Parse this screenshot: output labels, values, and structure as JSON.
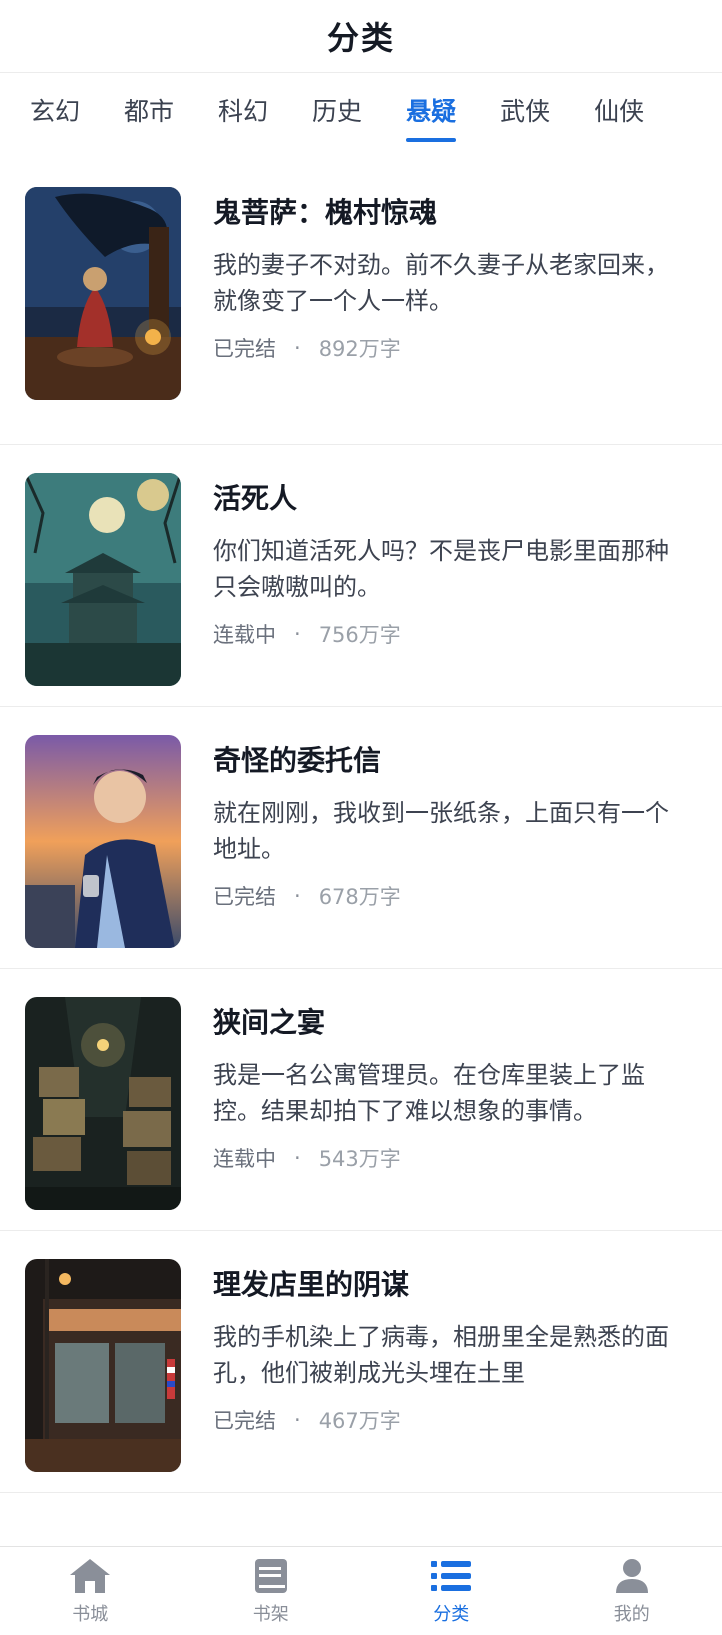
{
  "header": {
    "title": "分类"
  },
  "tabs": [
    {
      "label": "玄幻",
      "active": false
    },
    {
      "label": "都市",
      "active": false
    },
    {
      "label": "科幻",
      "active": false
    },
    {
      "label": "历史",
      "active": false
    },
    {
      "label": "悬疑",
      "active": true
    },
    {
      "label": "武侠",
      "active": false
    },
    {
      "label": "仙侠",
      "active": false
    }
  ],
  "books": [
    {
      "title": "鬼菩萨：槐村惊魂",
      "desc": "我的妻子不对劲。前不久妻子从老家回来，就像变了一个人一样。",
      "status": "已完结",
      "dot": "·",
      "words": "892万字"
    },
    {
      "title": "活死人",
      "desc": "你们知道活死人吗？不是丧尸电影里面那种只会嗷嗷叫的。",
      "status": "连载中",
      "dot": "·",
      "words": "756万字"
    },
    {
      "title": "奇怪的委托信",
      "desc": "就在刚刚，我收到一张纸条，上面只有一个地址。",
      "status": "已完结",
      "dot": "·",
      "words": "678万字"
    },
    {
      "title": "狭间之宴",
      "desc": "我是一名公寓管理员。在仓库里装上了监控。结果却拍下了难以想象的事情。",
      "status": "连载中",
      "dot": "·",
      "words": "543万字"
    },
    {
      "title": "理发店里的阴谋",
      "desc": "我的手机染上了病毒，相册里全是熟悉的面孔，他们被剃成光头埋在土里",
      "status": "已完结",
      "dot": "·",
      "words": "467万字"
    }
  ],
  "bottom_nav": [
    {
      "label": "书城",
      "icon": "home-icon",
      "active": false
    },
    {
      "label": "书架",
      "icon": "bookshelf-icon",
      "active": false
    },
    {
      "label": "分类",
      "icon": "category-list-icon",
      "active": true
    },
    {
      "label": "我的",
      "icon": "user-icon",
      "active": false
    }
  ],
  "colors": {
    "accent": "#1a6fe0",
    "text": "#1f2430",
    "muted": "#8a8f99"
  }
}
